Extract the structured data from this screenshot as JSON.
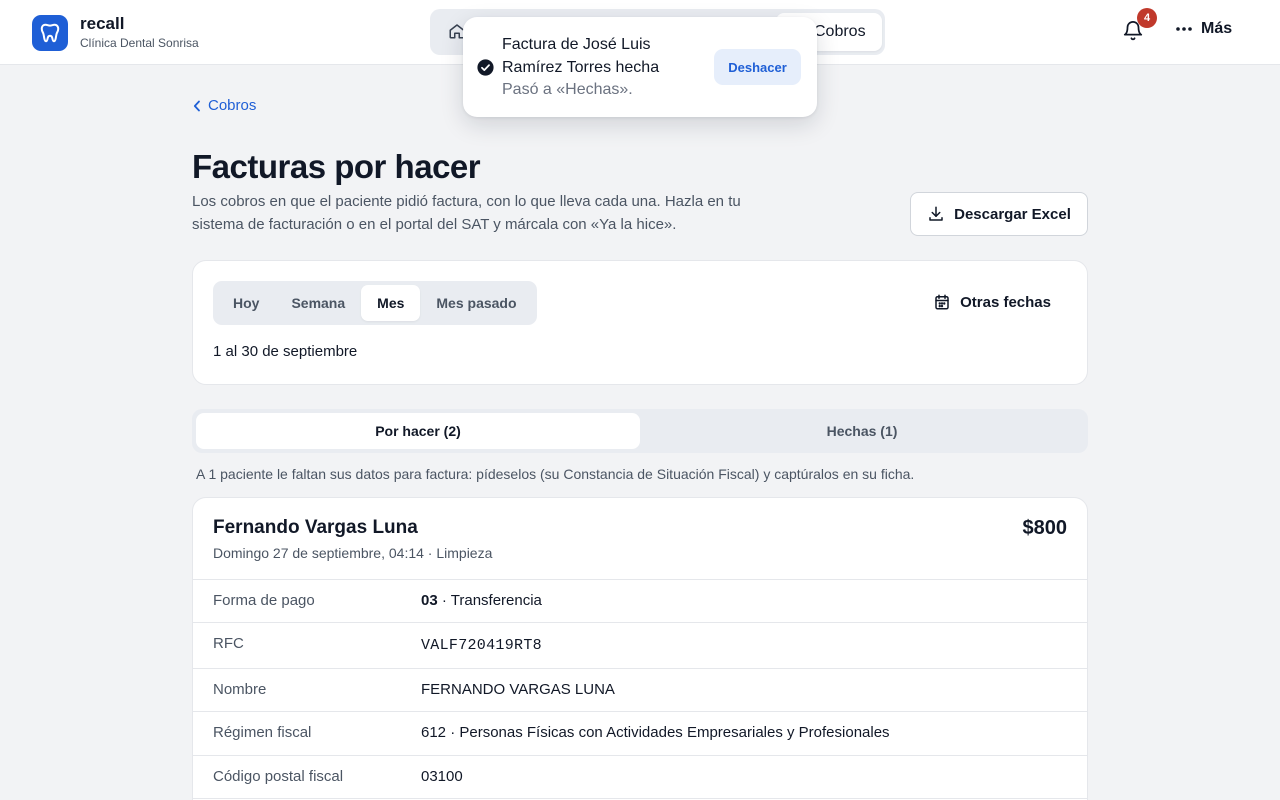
{
  "brand": {
    "name": "recall",
    "clinic": "Clínica Dental Sonrisa"
  },
  "nav": {
    "active_label": "Cobros"
  },
  "header": {
    "notifications_count": "4",
    "more_label": "Más"
  },
  "toast": {
    "title": "Factura de José Luis Ramírez Torres hecha",
    "subtitle": "Pasó a «Hechas».",
    "undo_label": "Deshacer"
  },
  "breadcrumb": {
    "back_label": "Cobros"
  },
  "page": {
    "title": "Facturas por hacer",
    "description": "Los cobros en que el paciente pidió factura, con lo que lleva cada una. Hazla en tu sistema de facturación o en el portal del SAT y márcala con «Ya la hice».",
    "download_label": "Descargar Excel"
  },
  "filters": {
    "periods": [
      "Hoy",
      "Semana",
      "Mes",
      "Mes pasado"
    ],
    "active_period": "Mes",
    "other_dates_label": "Otras fechas",
    "range_text": "1 al 30 de septiembre"
  },
  "tabs": {
    "pending_label": "Por hacer (2)",
    "done_label": "Hechas (1)"
  },
  "hint": "A 1 paciente le faltan sus datos para factura: pídeselos (su Constancia de Situación Fiscal) y captúralos en su ficha.",
  "invoice": {
    "patient_name": "Fernando Vargas Luna",
    "meta": "Domingo 27 de septiembre, 04:14 · Limpieza",
    "amount": "$800",
    "payment_label": "Forma de pago",
    "payment_code": "03",
    "payment_text": " · Transferencia",
    "rfc_label": "RFC",
    "rfc_value": "VALF720419RT8",
    "name_label": "Nombre",
    "name_value": "FERNANDO VARGAS LUNA",
    "regime_label": "Régimen fiscal",
    "regime_value": "612 · Personas Físicas con Actividades Empresariales y Profesionales",
    "zip_label": "Código postal fiscal",
    "zip_value": "03100"
  },
  "colors": {
    "accent": "#1f5fd6",
    "badge": "#c0392b",
    "background": "#f2f3f5"
  }
}
